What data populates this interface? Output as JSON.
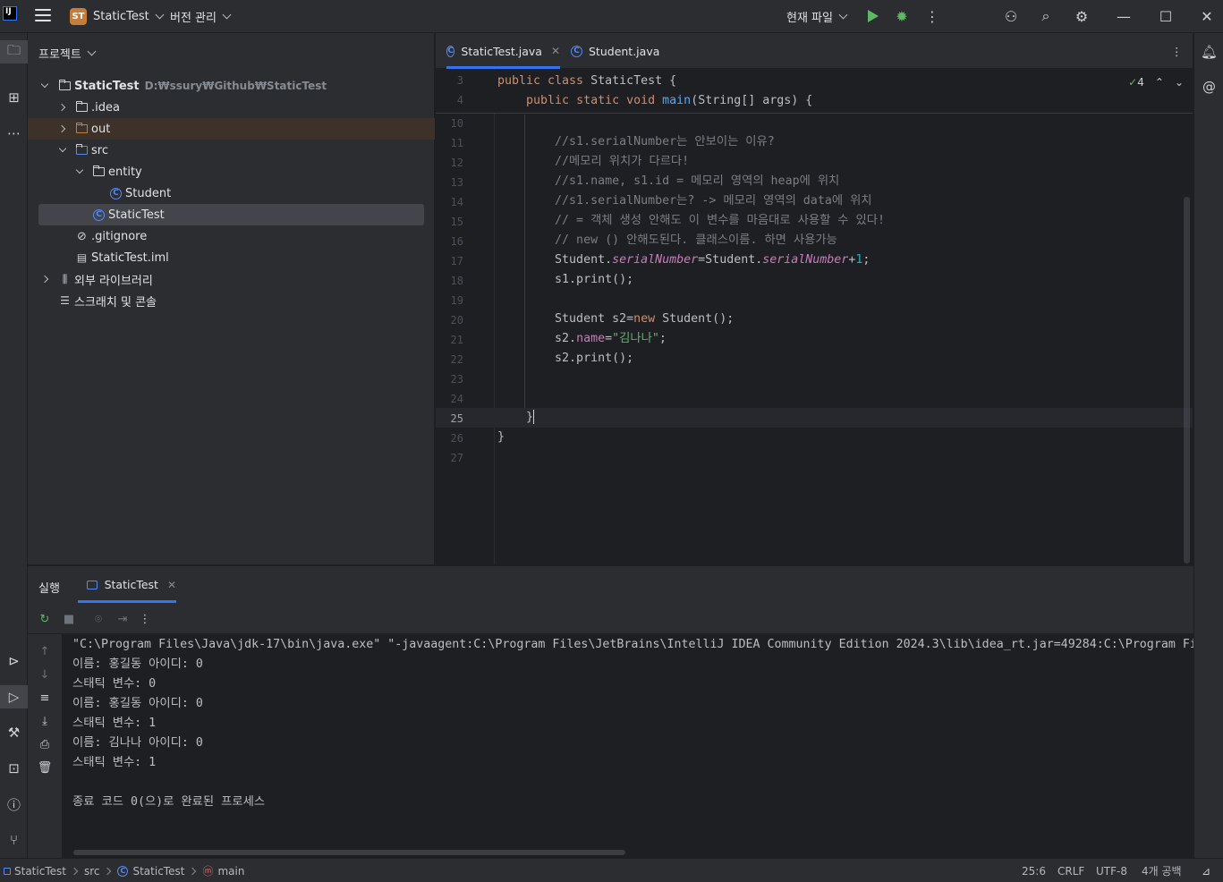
{
  "titlebar": {
    "project_badge": "ST",
    "project_name": "StaticTest",
    "vcs_label": "버전 관리",
    "run_config": "현재 파일"
  },
  "project_panel": {
    "title": "프로젝트",
    "tree": [
      {
        "label": "StaticTest",
        "hint": "D:₩ssury₩Github₩StaticTest"
      },
      {
        "label": ".idea"
      },
      {
        "label": "out"
      },
      {
        "label": "src"
      },
      {
        "label": "entity"
      },
      {
        "label": "Student"
      },
      {
        "label": "StaticTest"
      },
      {
        "label": ".gitignore"
      },
      {
        "label": "StaticTest.iml"
      },
      {
        "label": "외부 라이브러리"
      },
      {
        "label": "스크래치 및 콘솔"
      }
    ]
  },
  "editor": {
    "tabs": [
      {
        "label": "StaticTest.java"
      },
      {
        "label": "Student.java"
      }
    ],
    "inspection_count": "4",
    "current_line": "25"
  },
  "run_panel": {
    "title": "실행",
    "tab_label": "StaticTest",
    "console": [
      "\"C:\\Program Files\\Java\\jdk-17\\bin\\java.exe\" \"-javaagent:C:\\Program Files\\JetBrains\\IntelliJ IDEA Community Edition 2024.3\\lib\\idea_rt.jar=49284:C:\\Program Fi",
      "이름: 홍길동 아이디: 0",
      "스태틱 변수: 0",
      "이름: 홍길동 아이디: 0",
      "스태틱 변수: 1",
      "이름: 김나나 아이디: 0",
      "스태틱 변수: 1",
      "",
      "종료 코드 0(으)로 완료된 프로세스"
    ]
  },
  "statusbar": {
    "crumbs": [
      "StaticTest",
      "src",
      "StaticTest",
      "main"
    ],
    "position": "25:6",
    "line_sep": "CRLF",
    "encoding": "UTF-8",
    "indent": "4개 공백"
  },
  "colors": {
    "accent": "#3574f0",
    "run_green": "#5fb865",
    "keyword": "#cf8e6d",
    "string": "#6aab73"
  }
}
